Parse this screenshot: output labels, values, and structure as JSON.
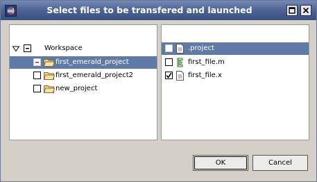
{
  "dialog": {
    "title": "Select files to be transfered and launched",
    "title_bar_color": "#4f6596"
  },
  "icons": {
    "app": "eclipse-icon",
    "maximize": "maximize-icon",
    "close": "close-icon",
    "folder": "folder-icon",
    "file": "file-icon",
    "matlab_file": "matlab-file-icon"
  },
  "tree": {
    "root": {
      "label": "Workspace",
      "expanded": true,
      "checkbox": "partial"
    },
    "items": [
      {
        "label": "first_emerald_project",
        "checkbox": "partial",
        "selected": true
      },
      {
        "label": "first_emerald_project2",
        "checkbox": "unchecked",
        "selected": false
      },
      {
        "label": "new_project",
        "checkbox": "unchecked",
        "selected": false
      }
    ]
  },
  "files": {
    "items": [
      {
        "label": ".project",
        "checked": false,
        "selected": true
      },
      {
        "label": "first_file.m",
        "checked": false,
        "selected": false
      },
      {
        "label": "first_file.x",
        "checked": true,
        "selected": false
      }
    ]
  },
  "buttons": {
    "ok": "OK",
    "cancel": "Cancel"
  },
  "colors": {
    "selection": "#5f7aa6",
    "dialog_background": "#d4d0c8"
  }
}
